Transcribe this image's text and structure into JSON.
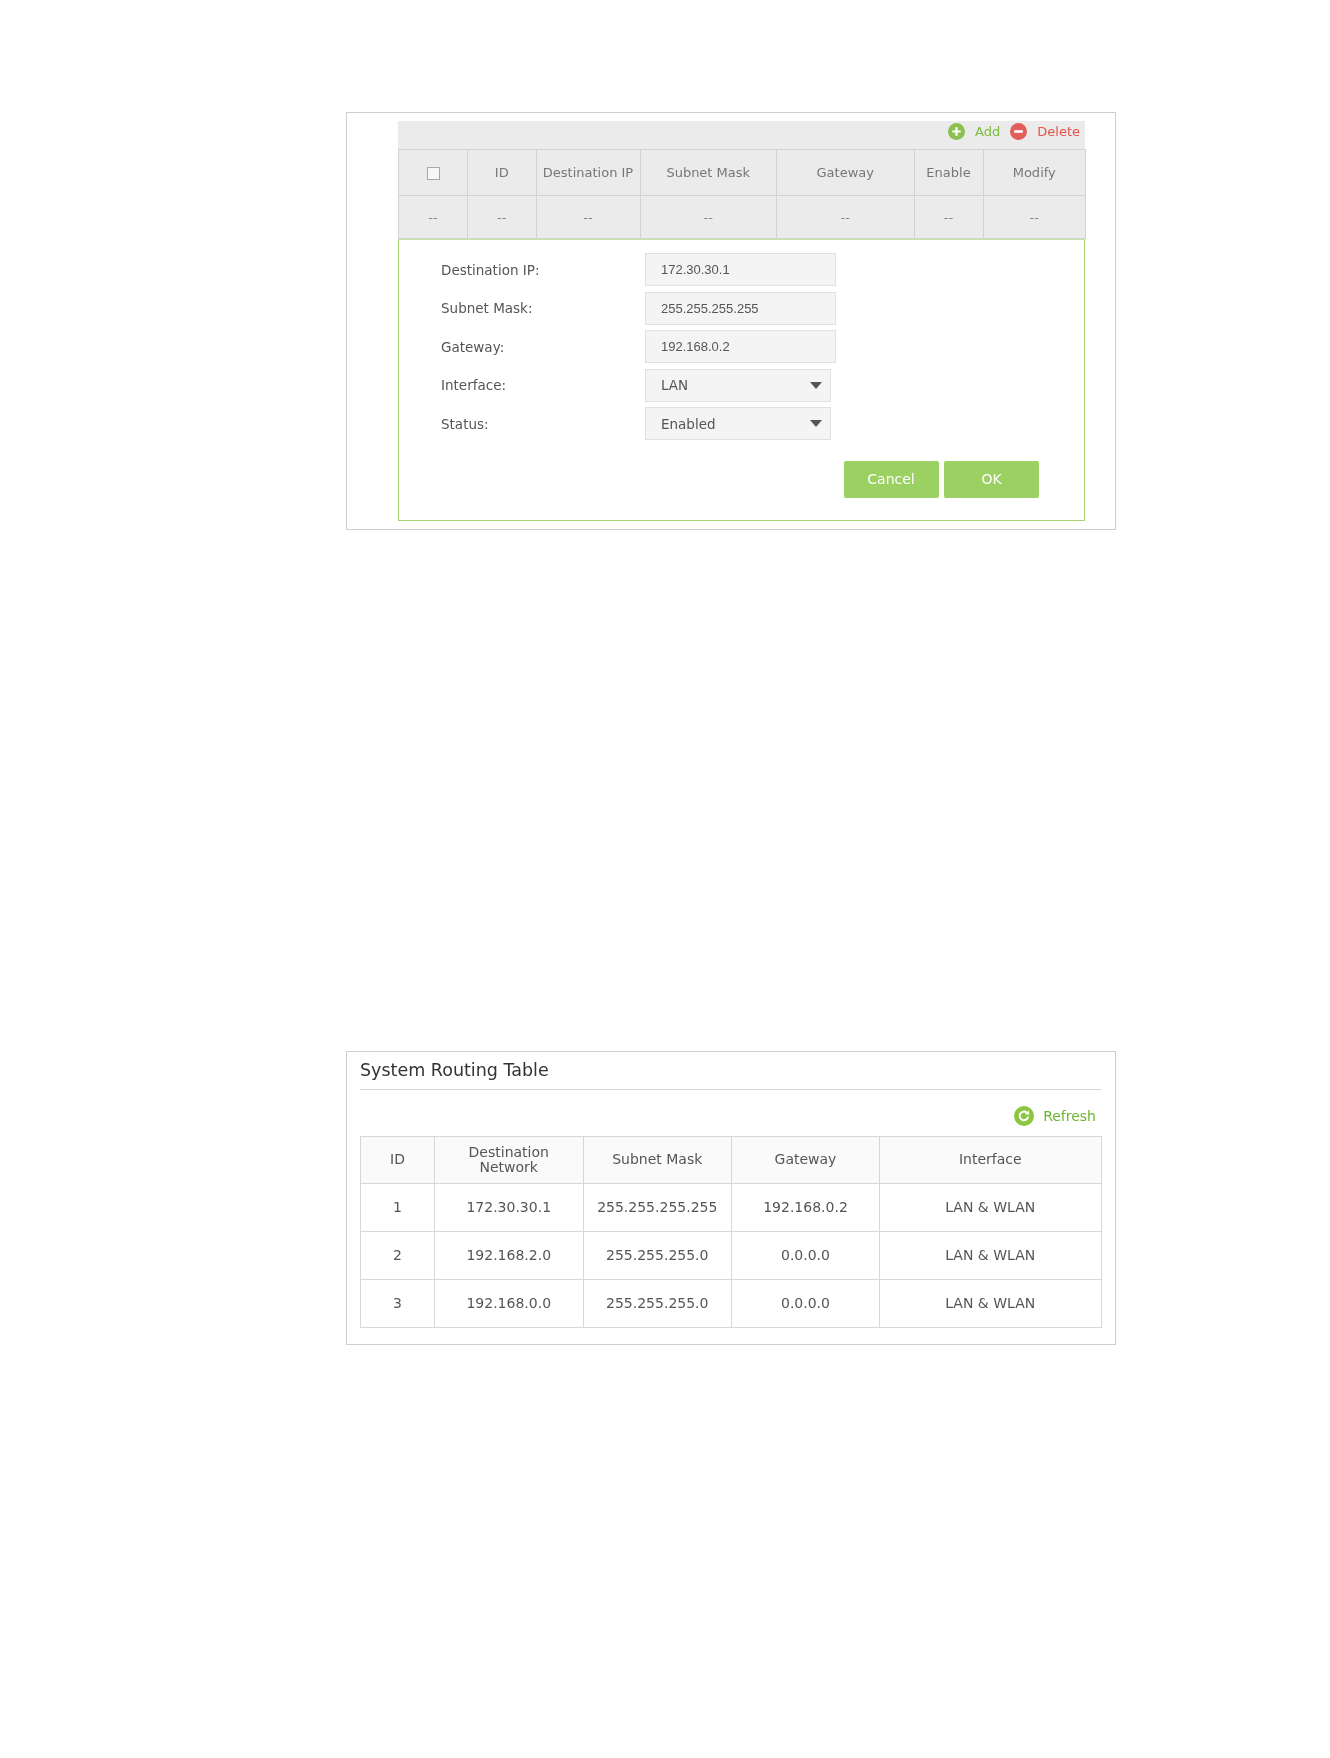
{
  "static_routes": {
    "toolbar": [
      {
        "kind": "add",
        "label": "Add"
      },
      {
        "kind": "delete",
        "label": "Delete"
      }
    ],
    "table": {
      "select_all": {
        "checked": false
      },
      "columns": [
        "",
        "ID",
        "Destination IP",
        "Subnet Mask",
        "Gateway",
        "Enable",
        "Modify"
      ],
      "rows": [
        [
          "--",
          "--",
          "--",
          "--",
          "--",
          "--",
          "--"
        ]
      ]
    },
    "form": {
      "fields": [
        {
          "kind": "text",
          "label": "Destination IP:",
          "value": "172.30.30.1"
        },
        {
          "kind": "text",
          "label": "Subnet Mask:",
          "value": "255.255.255.255"
        },
        {
          "kind": "text",
          "label": "Gateway:",
          "value": "192.168.0.2"
        },
        {
          "kind": "select",
          "label": "Interface:",
          "value": "LAN"
        },
        {
          "kind": "select",
          "label": "Status:",
          "value": "Enabled"
        }
      ],
      "buttons": [
        "Cancel",
        "OK"
      ]
    }
  },
  "system_routing_table": {
    "title": "System Routing Table",
    "actions": [
      {
        "kind": "refresh",
        "label": "Refresh"
      }
    ],
    "columns": [
      "ID",
      "Destination Network",
      "Subnet Mask",
      "Gateway",
      "Interface"
    ],
    "rows": [
      [
        "1",
        "172.30.30.1",
        "255.255.255.255",
        "192.168.0.2",
        "LAN & WLAN"
      ],
      [
        "2",
        "192.168.2.0",
        "255.255.255.0",
        "0.0.0.0",
        "LAN & WLAN"
      ],
      [
        "3",
        "192.168.0.0",
        "255.255.255.0",
        "0.0.0.0",
        "LAN & WLAN"
      ]
    ]
  }
}
